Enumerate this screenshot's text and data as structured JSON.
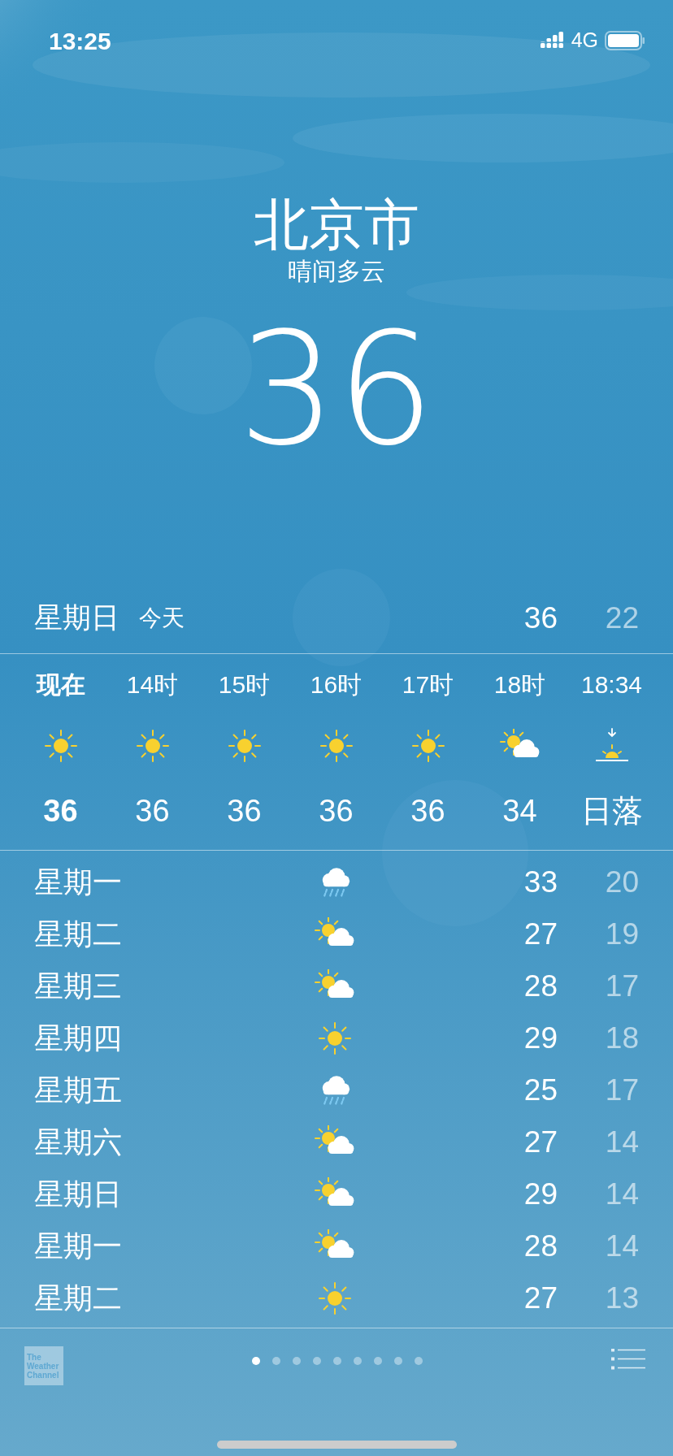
{
  "status_bar": {
    "time": "13:25",
    "network": "4G"
  },
  "location": {
    "city": "北京市",
    "condition": "晴间多云",
    "temperature": "36"
  },
  "today": {
    "day": "星期日",
    "label": "今天",
    "high": "36",
    "low": "22"
  },
  "hourly": [
    {
      "time": "现在",
      "kind": "sun",
      "temp": "36",
      "current": true
    },
    {
      "time": "14时",
      "kind": "sun",
      "temp": "36",
      "current": false
    },
    {
      "time": "15时",
      "kind": "sun",
      "temp": "36",
      "current": false
    },
    {
      "time": "16时",
      "kind": "sun",
      "temp": "36",
      "current": false
    },
    {
      "time": "17时",
      "kind": "sun",
      "temp": "36",
      "current": false
    },
    {
      "time": "18时",
      "kind": "partly_cloudy",
      "temp": "34",
      "current": false
    },
    {
      "time": "18:34",
      "kind": "sunset",
      "temp": "日落",
      "current": false
    }
  ],
  "daily": [
    {
      "day": "星期一",
      "kind": "rain",
      "high": "33",
      "low": "20"
    },
    {
      "day": "星期二",
      "kind": "partly_cloudy",
      "high": "27",
      "low": "19"
    },
    {
      "day": "星期三",
      "kind": "partly_cloudy",
      "high": "28",
      "low": "17"
    },
    {
      "day": "星期四",
      "kind": "sun",
      "high": "29",
      "low": "18"
    },
    {
      "day": "星期五",
      "kind": "rain",
      "high": "25",
      "low": "17"
    },
    {
      "day": "星期六",
      "kind": "partly_cloudy",
      "high": "27",
      "low": "14"
    },
    {
      "day": "星期日",
      "kind": "partly_cloudy",
      "high": "29",
      "low": "14"
    },
    {
      "day": "星期一",
      "kind": "partly_cloudy",
      "high": "28",
      "low": "14"
    },
    {
      "day": "星期二",
      "kind": "sun",
      "high": "27",
      "low": "13"
    }
  ],
  "footer": {
    "logo_lines": [
      "The",
      "Weather",
      "Channel"
    ],
    "page_dots": [
      {
        "selected": true
      },
      {
        "selected": false
      },
      {
        "selected": false
      },
      {
        "selected": false
      },
      {
        "selected": false
      },
      {
        "selected": false
      },
      {
        "selected": false
      },
      {
        "selected": false
      },
      {
        "selected": false
      }
    ]
  }
}
